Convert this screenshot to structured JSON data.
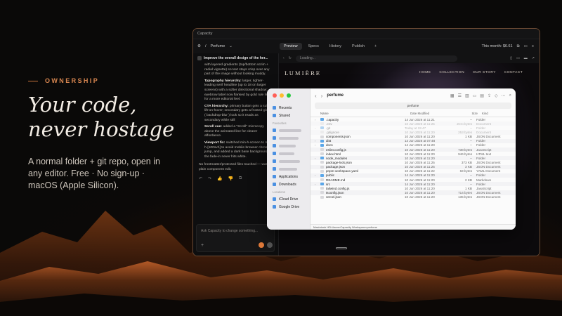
{
  "hero": {
    "eyebrow": "OWNERSHIP",
    "headline_line1": "Your code,",
    "headline_line2": "never hostage",
    "subcopy": "A normal folder + git repo, open in any editor. Free · No sign-up · macOS (Apple Silicon)."
  },
  "app": {
    "window_title": "Capacity",
    "project": "Perfume",
    "tabs": [
      {
        "label": "Preview",
        "active": true
      },
      {
        "label": "Specs",
        "active": false
      },
      {
        "label": "History",
        "active": false
      },
      {
        "label": "Publish",
        "active": false
      }
    ],
    "month_cost": "This month: $6.61",
    "address": "Loading..."
  },
  "chat": {
    "prompt": "Improve the overall design of the her...",
    "intro": "with layered gradients (top/bottom scrim + radial vignette) so text stays crisp over any part of the image without looking muddy.",
    "bullets": [
      {
        "title": "Typography hierarchy:",
        "text": "larger, tighter-leading serif headline (up to 18 on larger screens) with a softer directional shadow; eyebrow label now flanked by gold rule lines for a more editorial feel."
      },
      {
        "title": "CTA hierarchy:",
        "text": "primary button gets a subtle lift-on-hover; secondary gets a frosted-glass ( backdrop-blur ) look so it reads as secondary while still"
      },
      {
        "title": "Scroll cue:",
        "text": "added a \"Scroll\" microcopy above the animated line for clearer affordance."
      },
      {
        "title": "Viewport fix:",
        "text": "switched min-h-screen to min-h-[100svh] to avoid mobile browser chrome jump, and added a dark base background so the fade-in never hits white."
      }
    ],
    "footnote": "No frontmatter/protected files touched — was a plain component edit.",
    "input_placeholder": "Ask Capacity to change something..."
  },
  "preview": {
    "brand": "LUMIÈRE",
    "nav": [
      "HOME",
      "COLLECTION",
      "OUR STORY",
      "CONTACT"
    ]
  },
  "finder": {
    "title": "perfume",
    "path": "perfume",
    "sidebar": {
      "top": [
        "Recents",
        "Shared"
      ],
      "favorites_label": "Favourites",
      "favorites_bottom": [
        "Applications",
        "Downloads"
      ],
      "locations_label": "Locations",
      "locations": [
        "iCloud Drive",
        "Google Drive"
      ]
    },
    "columns": {
      "name": "Name",
      "date": "Date Modified",
      "size": "Size",
      "kind": "Kind"
    },
    "rows": [
      {
        "name": ".capacity",
        "date": "14 Jun 2026 at 11:21",
        "size": "--",
        "kind": "Folder",
        "type": "folder",
        "disclosure": true,
        "dim": false
      },
      {
        "name": ".env",
        "date": "10 Jun 2026 at 11:25",
        "size": "Zero bytes",
        "kind": "Document",
        "type": "doc",
        "disclosure": false,
        "dim": true
      },
      {
        "name": ".git",
        "date": "Today at 15:47",
        "size": "--",
        "kind": "Folder",
        "type": "folder",
        "disclosure": true,
        "dim": true
      },
      {
        "name": ".gitignore",
        "date": "10 Jun 2026 at 11:20",
        "size": "253 bytes",
        "kind": "Document",
        "type": "doc",
        "disclosure": false,
        "dim": true
      },
      {
        "name": "components.json",
        "date": "10 Jun 2026 at 11:20",
        "size": "1 KB",
        "kind": "JSON Document",
        "type": "doc",
        "disclosure": false,
        "dim": false
      },
      {
        "name": "dist",
        "date": "14 Jun 2026 at 07:48",
        "size": "--",
        "kind": "Folder",
        "type": "folder",
        "disclosure": true,
        "dim": false
      },
      {
        "name": "docs",
        "date": "14 Jun 2026 at 11:20",
        "size": "--",
        "kind": "Folder",
        "type": "folder",
        "disclosure": true,
        "dim": false
      },
      {
        "name": "eslint.config.js",
        "date": "10 Jun 2026 at 11:20",
        "size": "738 bytes",
        "kind": "JavaScript",
        "type": "doc",
        "disclosure": false,
        "dim": false
      },
      {
        "name": "index.html",
        "date": "10 Jun 2026 at 11:20",
        "size": "946 bytes",
        "kind": "HTML text",
        "type": "doc",
        "disclosure": false,
        "dim": false
      },
      {
        "name": "node_modules",
        "date": "10 Jun 2026 at 11:20",
        "size": "--",
        "kind": "Folder",
        "type": "folder",
        "disclosure": true,
        "dim": false
      },
      {
        "name": "package-lock.json",
        "date": "10 Jun 2026 at 11:25",
        "size": "373 KB",
        "kind": "JSON Document",
        "type": "doc",
        "disclosure": false,
        "dim": false
      },
      {
        "name": "package.json",
        "date": "10 Jun 2026 at 11:25",
        "size": "3 KB",
        "kind": "JSON Document",
        "type": "doc",
        "disclosure": false,
        "dim": false
      },
      {
        "name": "pnpm-workspace.yaml",
        "date": "10 Jun 2026 at 11:22",
        "size": "63 bytes",
        "kind": "YAML Document",
        "type": "doc",
        "disclosure": false,
        "dim": false
      },
      {
        "name": "public",
        "date": "14 Jun 2026 at 11:20",
        "size": "--",
        "kind": "Folder",
        "type": "folder",
        "disclosure": true,
        "dim": false
      },
      {
        "name": "README.md",
        "date": "10 Jun 2026 at 11:20",
        "size": "2 KB",
        "kind": "Markdown",
        "type": "doc",
        "disclosure": false,
        "dim": false
      },
      {
        "name": "src",
        "date": "14 Jun 2026 at 11:20",
        "size": "--",
        "kind": "Folder",
        "type": "folder",
        "disclosure": true,
        "dim": false
      },
      {
        "name": "tailwind.config.js",
        "date": "10 Jun 2026 at 11:20",
        "size": "1 KB",
        "kind": "JavaScript",
        "type": "doc",
        "disclosure": false,
        "dim": false
      },
      {
        "name": "tsconfig.json",
        "date": "10 Jun 2026 at 11:20",
        "size": "714 bytes",
        "kind": "JSON Document",
        "type": "doc",
        "disclosure": false,
        "dim": false
      },
      {
        "name": "vercel.json",
        "date": "10 Jun 2026 at 11:20",
        "size": "135 bytes",
        "kind": "JSON Document",
        "type": "doc",
        "disclosure": false,
        "dim": false
      }
    ],
    "status_path": [
      "Macintosh HD",
      "Users",
      "Capacity Workspace",
      "perfume"
    ]
  },
  "colors": {
    "accent": "#d88650",
    "folder": "#5aa6e8",
    "doc": "#d8d8dc",
    "light_red": "#ff5f57",
    "light_yellow": "#febc2e",
    "light_green": "#28c840",
    "send_orange": "#e07a3a"
  }
}
